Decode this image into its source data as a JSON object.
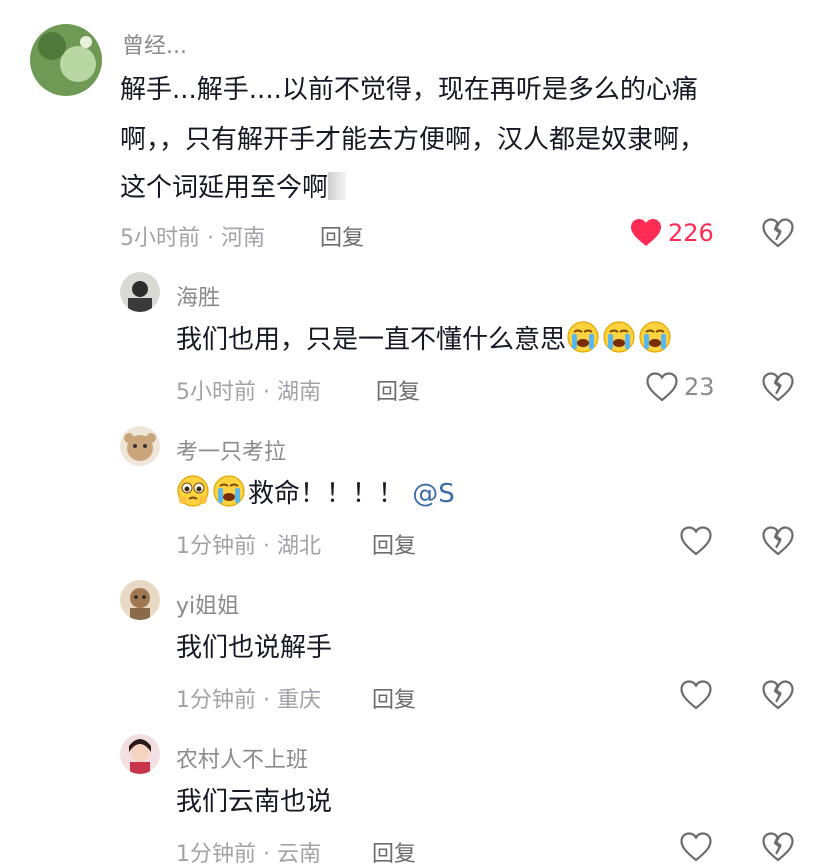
{
  "comments": [
    {
      "author": "曾经...",
      "lines": [
        "解手...解手....以前不觉得，现在再听是多么的心痛",
        "啊，，只有解开手才能去方便啊，汉人都是奴隶啊，",
        "这个词延用至今啊"
      ],
      "time": "5小时前",
      "region": "河南",
      "reply": "回复",
      "likes": "226",
      "liked": true
    },
    {
      "author": "海胜",
      "text": "我们也用，只是一直不懂什么意思",
      "time": "5小时前",
      "region": "湖南",
      "reply": "回复",
      "likes": "23",
      "liked": false
    },
    {
      "author": "考一只考拉",
      "text": "救命！！！！",
      "mention": "@S",
      "time": "1分钟前",
      "region": "湖北",
      "reply": "回复",
      "likes": "",
      "liked": false
    },
    {
      "author": "yi姐姐",
      "text": "我们也说解手",
      "time": "1分钟前",
      "region": "重庆",
      "reply": "回复",
      "likes": "",
      "liked": false
    },
    {
      "author": "农村人不上班",
      "text": "我们云南也说",
      "time": "1分钟前",
      "region": "云南",
      "reply": "回复",
      "likes": "",
      "liked": false
    }
  ],
  "meta_separator": " · ",
  "colors": {
    "like_active": "#fe2c55",
    "meta": "#a2a2a8",
    "mention": "#3b6ca8"
  },
  "icons": {
    "like": "heart-icon",
    "dislike": "broken-heart-icon",
    "emoji": "loudly-crying-face"
  }
}
